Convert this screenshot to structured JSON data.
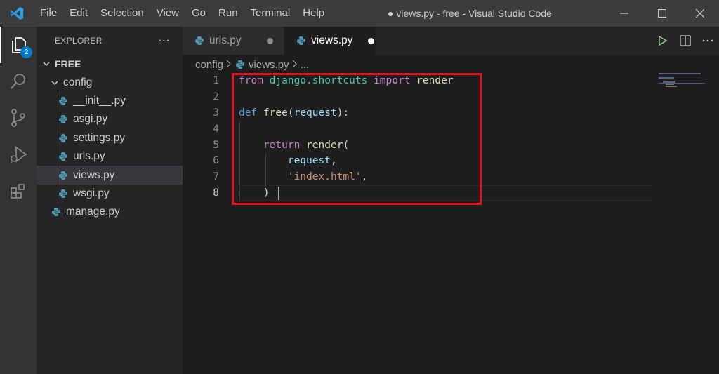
{
  "menu": [
    "File",
    "Edit",
    "Selection",
    "View",
    "Go",
    "Run",
    "Terminal",
    "Help"
  ],
  "window_title": "● views.py - free - Visual Studio Code",
  "activity": {
    "explorer_badge": "2"
  },
  "sidebar": {
    "header": "EXPLORER",
    "more": "···",
    "root": "FREE",
    "folder": "config",
    "files": [
      "__init__.py",
      "asgi.py",
      "settings.py",
      "urls.py",
      "views.py",
      "wsgi.py"
    ],
    "root_files": [
      "manage.py"
    ],
    "selected": "views.py"
  },
  "tabs": [
    {
      "label": "urls.py",
      "modified": true,
      "active": false
    },
    {
      "label": "views.py",
      "modified": true,
      "active": true
    }
  ],
  "breadcrumb": {
    "folder": "config",
    "file": "views.py",
    "more": "..."
  },
  "editor": {
    "line_numbers": [
      "1",
      "2",
      "3",
      "4",
      "5",
      "6",
      "7",
      "8"
    ],
    "current_line": "8",
    "code": {
      "l1_from": "from",
      "l1_module": "django.shortcuts",
      "l1_import": "import",
      "l1_name": "render",
      "l3_def": "def",
      "l3_fn": "free",
      "l3_open": "(",
      "l3_param": "request",
      "l3_close": "):",
      "l5_return": "return",
      "l5_fn": "render",
      "l5_open": "(",
      "l6_arg": "request",
      "l6_comma": ",",
      "l7_str": "'index.html'",
      "l7_comma": ",",
      "l8_close": ")"
    }
  },
  "colors": {
    "highlight_box": "#e2141c",
    "accent": "#007acc"
  }
}
